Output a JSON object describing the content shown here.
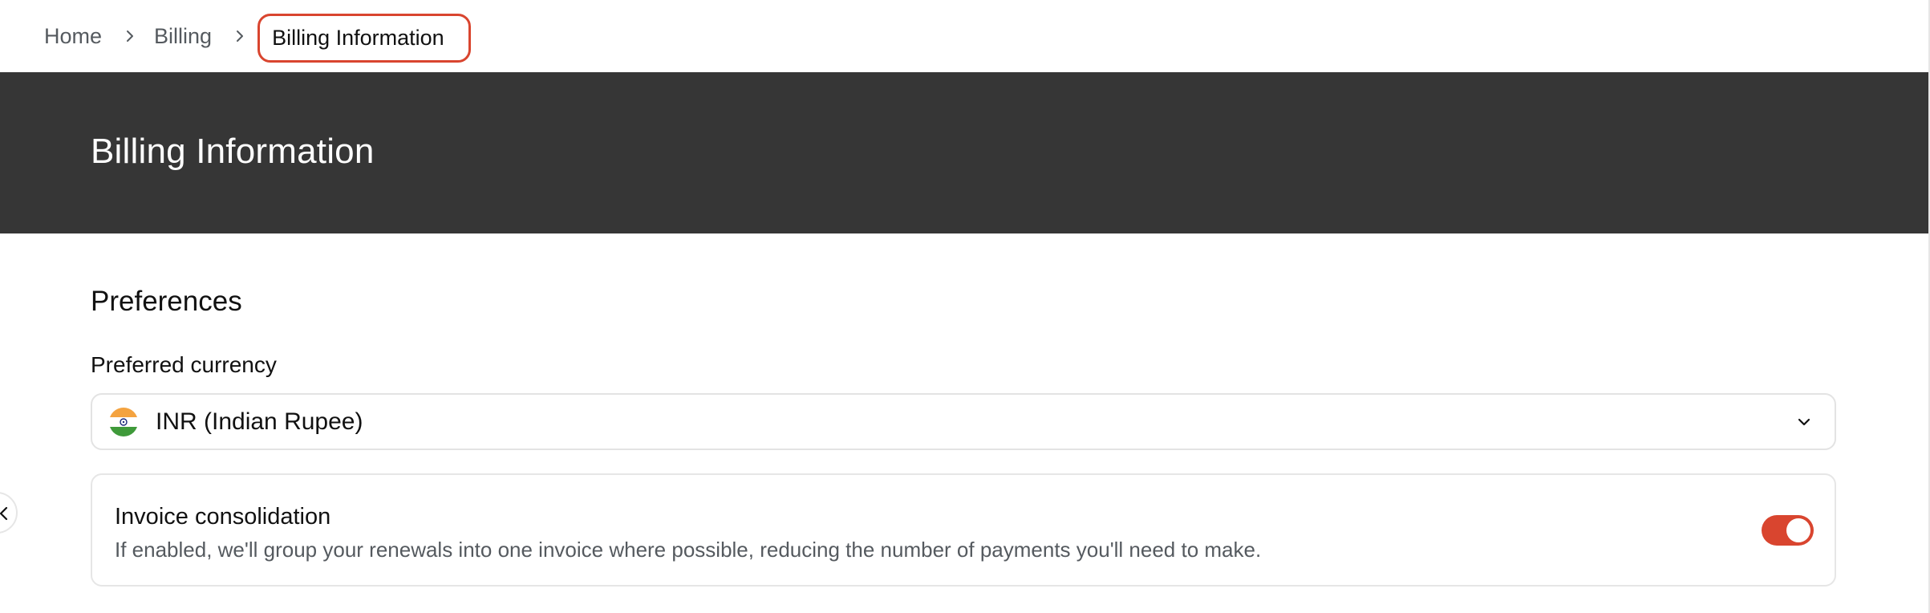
{
  "breadcrumb": {
    "items": [
      {
        "label": "Home"
      },
      {
        "label": "Billing"
      }
    ],
    "current": "Billing Information"
  },
  "banner": {
    "title": "Billing Information"
  },
  "preferences": {
    "title": "Preferences",
    "currency_label": "Preferred currency",
    "currency_value": "INR (Indian Rupee)",
    "currency_flag_icon": "india-flag-icon"
  },
  "invoice_consolidation": {
    "title": "Invoice consolidation",
    "description": "If enabled, we'll group your renewals into one invoice where possible, reducing the number of payments you'll need to make.",
    "enabled": true
  },
  "colors": {
    "accent": "#d9452f",
    "banner_bg": "#363636"
  }
}
